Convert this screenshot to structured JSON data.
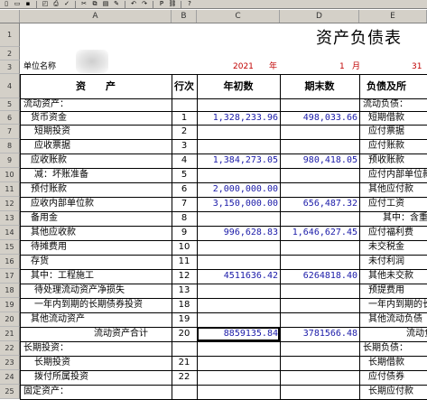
{
  "toolbar": {
    "icons": [
      "new-file",
      "open-folder",
      "save",
      "print-preview",
      "print",
      "spell-check",
      "cut",
      "copy",
      "paste",
      "format-painter",
      "undo",
      "redo",
      "bold",
      "hyperlink",
      "help"
    ],
    "glyphs": [
      "▯",
      "▭",
      "▪",
      "◰",
      "⎙",
      "✓",
      "✂",
      "⧉",
      "▤",
      "✎",
      "↶",
      "↷",
      "P",
      "⛓",
      "?"
    ]
  },
  "columns": [
    "A",
    "B",
    "C",
    "D",
    "E"
  ],
  "rows": [
    "1",
    "2",
    "3",
    "4",
    "5",
    "6",
    "7",
    "8",
    "9",
    "10",
    "11",
    "12",
    "13",
    "14",
    "15",
    "16",
    "17",
    "18",
    "19",
    "20",
    "21",
    "22",
    "23",
    "24",
    "25"
  ],
  "sheet": {
    "title": "资产负债表",
    "unit_label": "单位名称",
    "year_value": "2021",
    "year_label": "年",
    "month_value": "1",
    "month_label": "月",
    "day_value": "31",
    "headers": {
      "asset": "资　　产",
      "row_no": "行次",
      "begin": "年初数",
      "end": "期末数",
      "liab": "负债及所"
    }
  },
  "assets": [
    {
      "label": "流动资产：",
      "row": "",
      "begin": "",
      "end": ""
    },
    {
      "label": "货币资金",
      "row": "1",
      "begin": "1,328,233.96",
      "end": "498,033.66"
    },
    {
      "label": "短期投资",
      "row": "2",
      "begin": "",
      "end": ""
    },
    {
      "label": "应收票据",
      "row": "3",
      "begin": "",
      "end": ""
    },
    {
      "label": "应收账款",
      "row": "4",
      "begin": "1,384,273.05",
      "end": "980,418.05"
    },
    {
      "label": "减：坏账准备",
      "row": "5",
      "begin": "",
      "end": ""
    },
    {
      "label": "预付账款",
      "row": "6",
      "begin": "2,000,000.00",
      "end": ""
    },
    {
      "label": "应收内部单位款",
      "row": "7",
      "begin": "3,150,000.00",
      "end": "656,487.32"
    },
    {
      "label": "备用金",
      "row": "8",
      "begin": "",
      "end": ""
    },
    {
      "label": "其他应收款",
      "row": "9",
      "begin": "996,628.83",
      "end": "1,646,627.45"
    },
    {
      "label": "待摊费用",
      "row": "10",
      "begin": "",
      "end": ""
    },
    {
      "label": "存货",
      "row": "11",
      "begin": "",
      "end": ""
    },
    {
      "label": "其中：工程施工",
      "row": "12",
      "begin": "4511636.42",
      "end": "6264818.40"
    },
    {
      "label": "待处理流动资产净损失",
      "row": "13",
      "begin": "",
      "end": ""
    },
    {
      "label": "一年内到期的长期债券投资",
      "row": "18",
      "begin": "",
      "end": ""
    },
    {
      "label": "其他流动资产",
      "row": "19",
      "begin": "",
      "end": ""
    },
    {
      "label": "流动资产合计",
      "row": "20",
      "begin": "8859135.84",
      "end": "3781566.48"
    },
    {
      "label": "长期投资：",
      "row": "",
      "begin": "",
      "end": ""
    },
    {
      "label": "长期投资",
      "row": "21",
      "begin": "",
      "end": ""
    },
    {
      "label": "拨付所属投资",
      "row": "22",
      "begin": "",
      "end": ""
    },
    {
      "label": "固定资产：",
      "row": "",
      "begin": "",
      "end": ""
    }
  ],
  "liabilities": [
    "流动负债：",
    "短期借款",
    "应付票据",
    "应付账款",
    "预收账款",
    "应付内部单位款",
    "其他应付款",
    "应付工资",
    "其中：含重工",
    "应付福利费",
    "未交税金",
    "未付利润",
    "其他未交款",
    "预提费用",
    "一年内到期的长",
    "其他流动负债",
    "流动负",
    "长期负债：",
    "长期借款",
    "应付债券",
    "长期应付款"
  ]
}
